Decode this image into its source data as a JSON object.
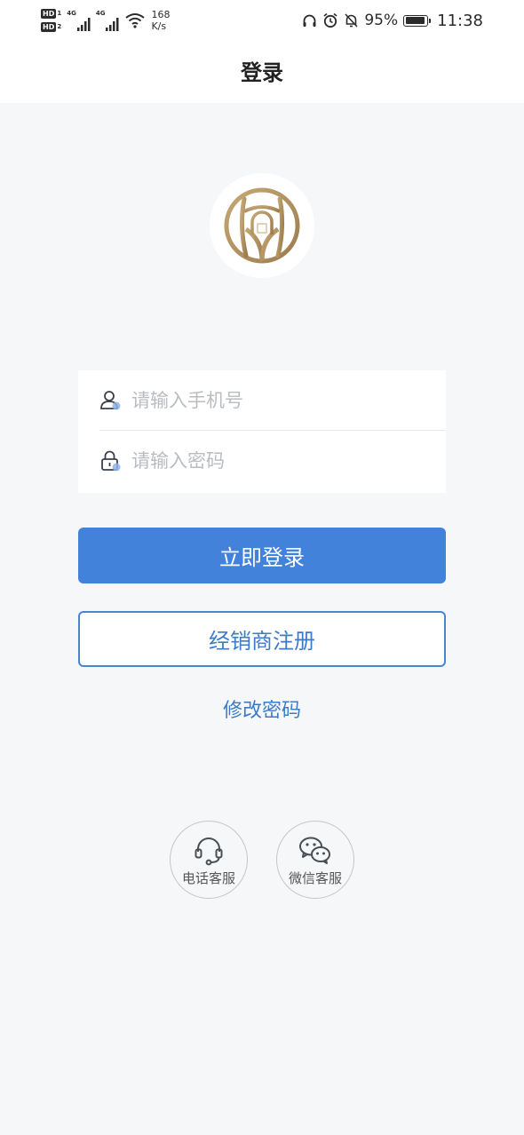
{
  "status_bar": {
    "hd1": "HD",
    "hd1_sub": "1",
    "hd2": "HD",
    "hd2_sub": "2",
    "net1": "4G",
    "net2": "4G",
    "speed_value": "168",
    "speed_unit": "K/s",
    "battery_percent": "95%",
    "battery_level": 0.95,
    "time": "11:38"
  },
  "nav": {
    "title": "登录"
  },
  "brand": {
    "logo_color": "#b0905f",
    "accent": "#4282db"
  },
  "form": {
    "phone_placeholder": "请输入手机号",
    "phone_value": "",
    "password_placeholder": "请输入密码",
    "password_value": ""
  },
  "actions": {
    "login_label": "立即登录",
    "register_label": "经销商注册",
    "change_password_label": "修改密码"
  },
  "services": {
    "phone_label": "电话客服",
    "wechat_label": "微信客服"
  }
}
